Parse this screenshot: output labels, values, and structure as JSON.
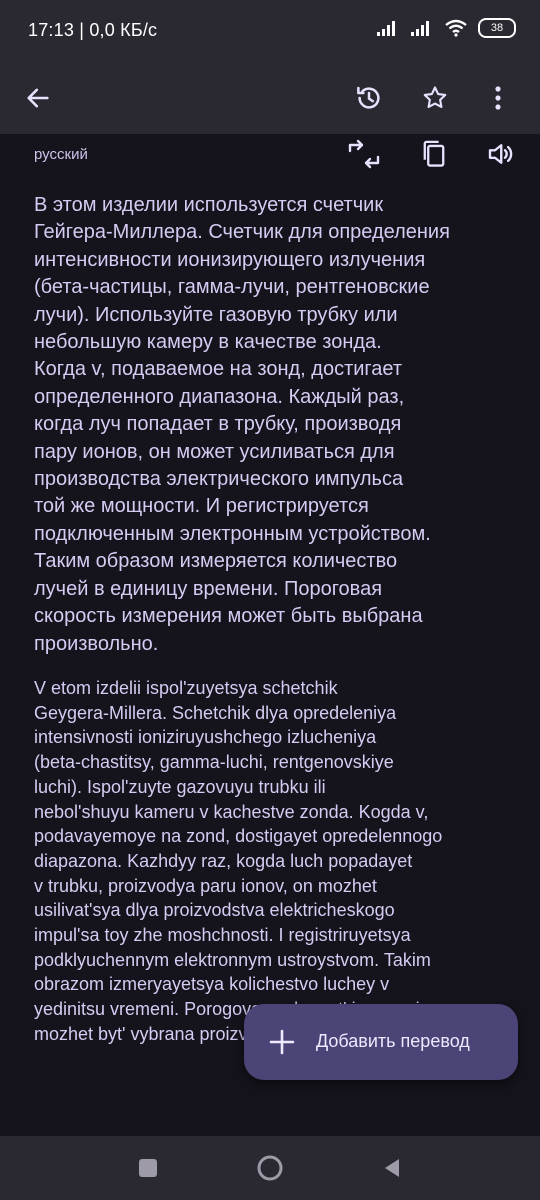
{
  "status_bar": {
    "time_speed": "17:13 | 0,0 КБ/с",
    "battery": "38"
  },
  "toolbar": {
    "back_icon": "arrow-left-icon",
    "history_icon": "history-icon",
    "favorite_icon": "star-outline-icon",
    "menu_icon": "more-vert-icon"
  },
  "result": {
    "language": "русский",
    "translation_lines": [
      "В этом изделии используется счетчик",
      "Гейгера-Миллера. Счетчик для определения",
      "интенсивности ионизирующего излучения",
      "(бета-частицы, гамма-лучи, рентгеновские",
      "лучи).  Используйте газовую трубку или",
      "небольшую камеру в качестве зонда.",
      "Когда v, подаваемое на зонд, достигает",
      "определенного диапазона.  Каждый раз,",
      "когда луч попадает в трубку, производя",
      "пару ионов, он может усиливаться для",
      "производства электрического импульса",
      "той же мощности.  И регистрируется",
      "подключенным электронным устройством.",
      "Таким образом измеряется количество",
      "лучей в единицу времени. Пороговая",
      "скорость измерения может быть выбрана",
      "произвольно."
    ],
    "transliteration_lines": [
      "V etom izdelii ispol'zuyetsya schetchik",
      "Geygera-Millera. Schetchik dlya opredeleniya",
      "intensivnosti ioniziruyushchego izlucheniya",
      "(beta-chastitsy, gamma-luchi, rentgenovskiye",
      "luchi). Ispol'zuyte gazovuyu trubku ili",
      "nebol'shuyu kameru v kachestve zonda. Kogda v,",
      "podavayemoye na zond, dostigayet opredelennogo",
      "diapazona. Kazhdyy raz, kogda luch popadayet",
      "v trubku, proizvodya paru ionov, on mozhet",
      "usilivat'sya dlya proizvodstva elektricheskogo",
      "impul'sa toy zhe moshchnosti. I registriruyetsya",
      "podklyuchennym elektronnym ustroystvom. Takim",
      "obrazom izmeryayetsya kolichestvo luchey v",
      "yedinitsu vremeni. Porogovaya skorost' izmereniya",
      "mozhet byt' vybrana proizvol'no."
    ],
    "tools": [
      "swap-translation-icon",
      "copy-icon",
      "volume-icon"
    ]
  },
  "fab": {
    "label": "Добавить перевод",
    "icon": "plus-icon"
  },
  "navigation": {
    "buttons": [
      "recents-square-icon",
      "home-circle-icon",
      "back-triangle-icon"
    ]
  },
  "colors": {
    "background": "#15131c",
    "bar": "#2a2831",
    "text": "#d6cbf2",
    "fab": "#4a4477"
  }
}
